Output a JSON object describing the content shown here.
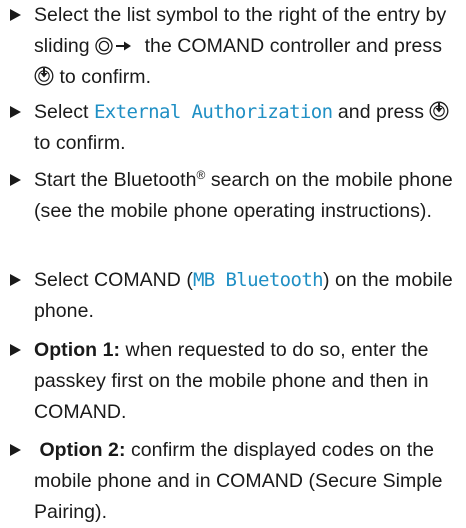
{
  "steps": [
    {
      "part1": "Select the list symbol to the right of the entry by sliding",
      "part2": "the COMAND controller and press",
      "part3": "to confirm.",
      "icon_slide": "controller-slide-right-icon",
      "icon_press": "controller-press-icon"
    },
    {
      "part1": "Select",
      "highlight": "External Authorization",
      "part2": "and press",
      "part3": "to confirm.",
      "icon_press": "controller-press-icon"
    },
    {
      "part1": "Start the Bluetooth",
      "sup": "®",
      "part2": "search on the mobile phone (see the mobile phone operating instructions)."
    },
    {
      "part1": "Select COMAND (",
      "highlight": "MB Bluetooth",
      "part2": ") on the mobile phone."
    },
    {
      "bold": "Option 1:",
      "text": "when requested to do so, enter the passkey first on the mobile phone and then in COMAND."
    },
    {
      "bold": "Option 2:",
      "text": "confirm the displayed codes on the mobile phone and in COMAND (Secure Simple Pairing)."
    }
  ],
  "colors": {
    "text": "#1a1a1a",
    "highlight": "#1f8fc4",
    "background": "#ffffff"
  }
}
